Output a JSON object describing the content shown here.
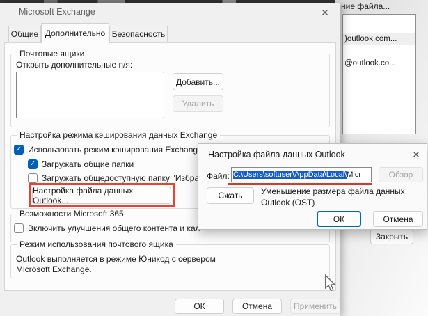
{
  "colors": {
    "accent_blue": "#005fb8",
    "selection_blue": "#155dcc",
    "annotation_red": "#e8432c",
    "annotation_underline_red": "#d43a28"
  },
  "icons": {
    "close": "✕",
    "check": "✓"
  },
  "background_window": {
    "title_fragment": "ние файла...",
    "list_items": [
      ")outlook.com...",
      "@outlook.co..."
    ],
    "close_button": "Закрыть"
  },
  "exchange_dialog": {
    "title": "Microsoft Exchange",
    "tabs": [
      {
        "label": "Общие"
      },
      {
        "label": "Дополнительно"
      },
      {
        "label": "Безопасность"
      }
    ],
    "mailboxes": {
      "legend": "Почтовые ящики",
      "open_label": "Открыть дополнительные п/я:",
      "add_button": "Добавить...",
      "delete_button": "Удалить"
    },
    "cached_mode": {
      "legend": "Настройка режима кэширования данных Exchange",
      "use_cached_checkbox": "Использовать режим кэширования Exchange",
      "shared_folders_checkbox": "Загружать общие папки",
      "public_folder_checkbox": "Загружать общедоступную папку ''Избран",
      "ost_settings_button": "Настройка файла данных Outlook..."
    },
    "m365": {
      "legend": "Возможности Microsoft 365",
      "improvements_checkbox": "Включить улучшения общего контента и кал"
    },
    "mailbox_mode": {
      "legend": "Режим использования почтового ящика",
      "line1": "Outlook выполняется в режиме Юникод с сервером",
      "line2": "Microsoft Exchange."
    },
    "footer": {
      "ok_button": "ОК",
      "cancel_button": "Отмена",
      "apply_button": "Применить"
    }
  },
  "ost_dialog": {
    "title": "Настройка файла данных Outlook",
    "file_label": "Файл:",
    "file_path_selected": "C:\\Users\\softuser\\AppData\\Local\\",
    "file_path_tail": "Micr",
    "browse_button": "Обзор",
    "compact_button": "Сжать",
    "description_line1": "Уменьшение размера файла данных",
    "description_line2": "Outlook (OST)",
    "ok_button": "ОК",
    "cancel_button": "Отмена"
  }
}
